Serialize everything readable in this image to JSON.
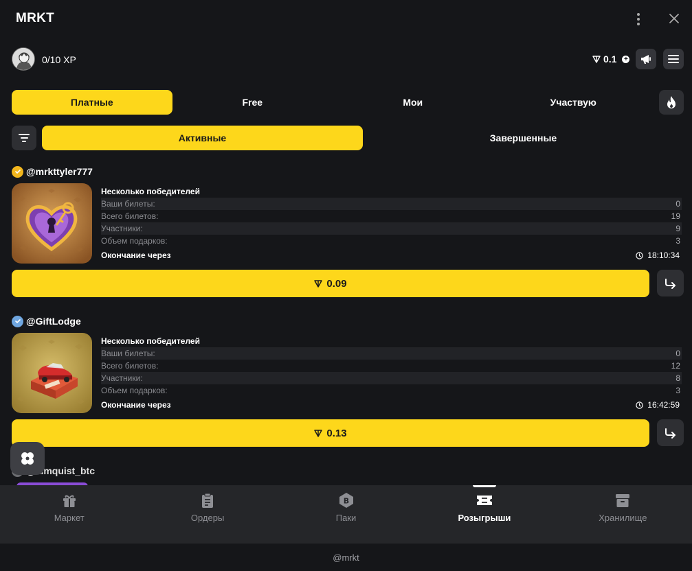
{
  "app": {
    "title": "MRKT"
  },
  "profile": {
    "xp": "0/10 XP",
    "balance": "0.1",
    "plus": "+"
  },
  "tabs_main": [
    {
      "label": "Платные",
      "active": true
    },
    {
      "label": "Free",
      "active": false
    },
    {
      "label": "Мои",
      "active": false
    },
    {
      "label": "Участвую",
      "active": false
    }
  ],
  "tabs_sub": [
    {
      "label": "Активные",
      "active": true
    },
    {
      "label": "Завершенные",
      "active": false
    }
  ],
  "cards": [
    {
      "owner": "@mrkttyler777",
      "badge_color": "#f2b61d",
      "heading": "Несколько победителей",
      "rows": [
        {
          "label": "Ваши билеты:",
          "value": "0"
        },
        {
          "label": "Всего билетов:",
          "value": "19"
        },
        {
          "label": "Участники:",
          "value": "9"
        },
        {
          "label": "Объем подарков:",
          "value": "3"
        }
      ],
      "end_label": "Окончание через",
      "end_time": "18:10:34",
      "price": "0.09"
    },
    {
      "owner": "@GiftLodge",
      "badge_color": "#6fa6e0",
      "heading": "Несколько победителей",
      "rows": [
        {
          "label": "Ваши билеты:",
          "value": "0"
        },
        {
          "label": "Всего билетов:",
          "value": "12"
        },
        {
          "label": "Участники:",
          "value": "8"
        },
        {
          "label": "Объем подарков:",
          "value": "3"
        }
      ],
      "end_label": "Окончание через",
      "end_time": "16:42:59",
      "price": "0.13"
    }
  ],
  "partial_owner": "@almquist_btc",
  "nav": [
    {
      "label": "Маркет",
      "icon": "gift-icon",
      "active": false
    },
    {
      "label": "Ордеры",
      "icon": "clipboard-icon",
      "active": false
    },
    {
      "label": "Паки",
      "icon": "pack-icon",
      "active": false
    },
    {
      "label": "Розыгрыши",
      "icon": "ticket-icon",
      "active": true
    },
    {
      "label": "Хранилище",
      "icon": "archive-icon",
      "active": false
    }
  ],
  "footer": "@mrkt"
}
